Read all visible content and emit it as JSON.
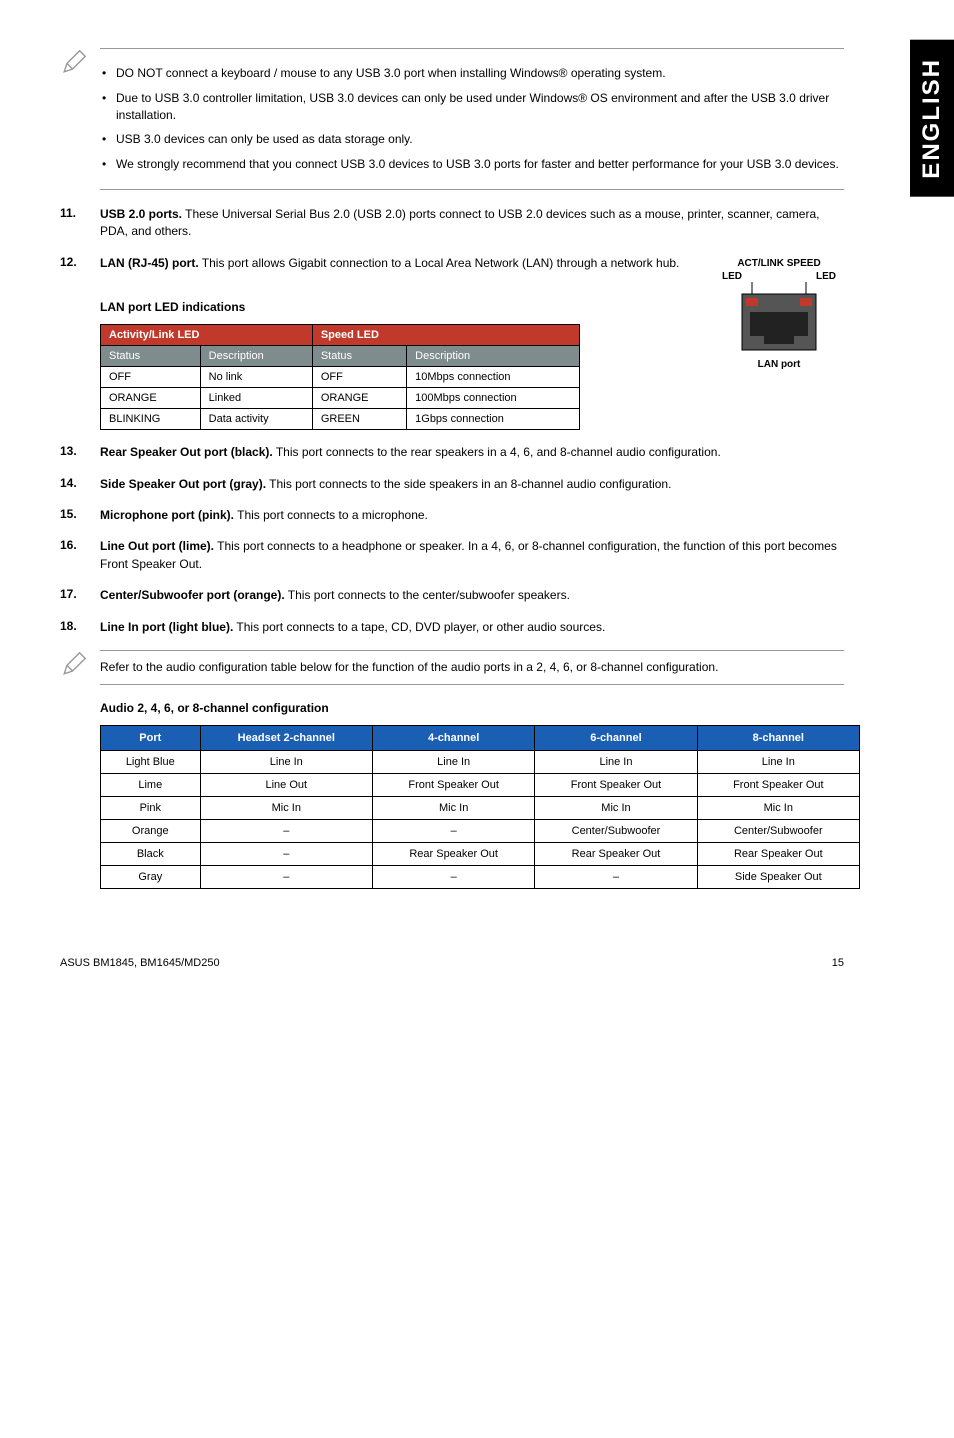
{
  "side_tab": "ENGLISH",
  "notes1": [
    "DO NOT connect a keyboard / mouse to any USB 3.0 port when installing Windows® operating system.",
    "Due to USB 3.0 controller limitation, USB 3.0 devices can only be used under Windows® OS environment and after the USB 3.0 driver installation.",
    "USB 3.0 devices can only be used as data storage only.",
    "We strongly recommend that you connect USB 3.0 devices to USB 3.0 ports for faster and better performance for your USB 3.0 devices."
  ],
  "items": {
    "i11": {
      "num": "11.",
      "title": "USB 2.0 ports.",
      "text": " These Universal Serial Bus 2.0 (USB 2.0) ports connect to USB 2.0 devices such as a mouse, printer, scanner, camera, PDA, and others."
    },
    "i12": {
      "num": "12.",
      "title": "LAN (RJ-45) port.",
      "text": " This port allows Gigabit connection to a Local Area Network (LAN) through a network hub."
    },
    "i13": {
      "num": "13.",
      "title": "Rear Speaker Out port (black).",
      "text": " This port connects to the rear speakers in a 4, 6, and 8-channel audio configuration."
    },
    "i14": {
      "num": "14.",
      "title": "Side Speaker Out port (gray).",
      "text": " This port connects to the side speakers in an 8-channel audio configuration."
    },
    "i15": {
      "num": "15.",
      "title": "Microphone port (pink).",
      "text": " This port connects to a microphone."
    },
    "i16": {
      "num": "16.",
      "title": "Line Out port (lime).",
      "text": " This port connects to a headphone or speaker. In a 4, 6, or 8-channel configuration, the function of this port becomes Front Speaker Out."
    },
    "i17": {
      "num": "17.",
      "title": "Center/Subwoofer port (orange).",
      "text": " This port connects to the center/subwoofer speakers."
    },
    "i18": {
      "num": "18.",
      "title": "Line In port (light blue).",
      "text": " This port connects to a tape, CD, DVD player, or other audio sources."
    }
  },
  "lan_head": "LAN port LED indications",
  "lan_diagram": {
    "top1": "ACT/LINK",
    "top2": "SPEED",
    "led": "LED",
    "port": "LAN port"
  },
  "lan_table": {
    "h1a": "Activity/Link LED",
    "h1b": "Speed LED",
    "h2a": "Status",
    "h2b": "Description",
    "h2c": "Status",
    "h2d": "Description",
    "rows": [
      [
        "OFF",
        "No link",
        "OFF",
        "10Mbps connection"
      ],
      [
        "ORANGE",
        "Linked",
        "ORANGE",
        "100Mbps connection"
      ],
      [
        "BLINKING",
        "Data activity",
        "GREEN",
        "1Gbps connection"
      ]
    ]
  },
  "note2": "Refer to the audio configuration table below for the function of the audio ports in a 2, 4, 6, or 8-channel configuration.",
  "audio_head": "Audio 2, 4, 6, or 8-channel configuration",
  "audio_table": {
    "headers": [
      "Port",
      "Headset 2-channel",
      "4-channel",
      "6-channel",
      "8-channel"
    ],
    "rows": [
      [
        "Light Blue",
        "Line In",
        "Line In",
        "Line In",
        "Line In"
      ],
      [
        "Lime",
        "Line Out",
        "Front Speaker Out",
        "Front Speaker Out",
        "Front Speaker Out"
      ],
      [
        "Pink",
        "Mic In",
        "Mic In",
        "Mic In",
        "Mic In"
      ],
      [
        "Orange",
        "–",
        "–",
        "Center/Subwoofer",
        "Center/Subwoofer"
      ],
      [
        "Black",
        "–",
        "Rear Speaker Out",
        "Rear Speaker Out",
        "Rear Speaker Out"
      ],
      [
        "Gray",
        "–",
        "–",
        "–",
        "Side Speaker Out"
      ]
    ]
  },
  "footer": {
    "left": "ASUS BM1845, BM1645/MD250",
    "right": "15"
  }
}
